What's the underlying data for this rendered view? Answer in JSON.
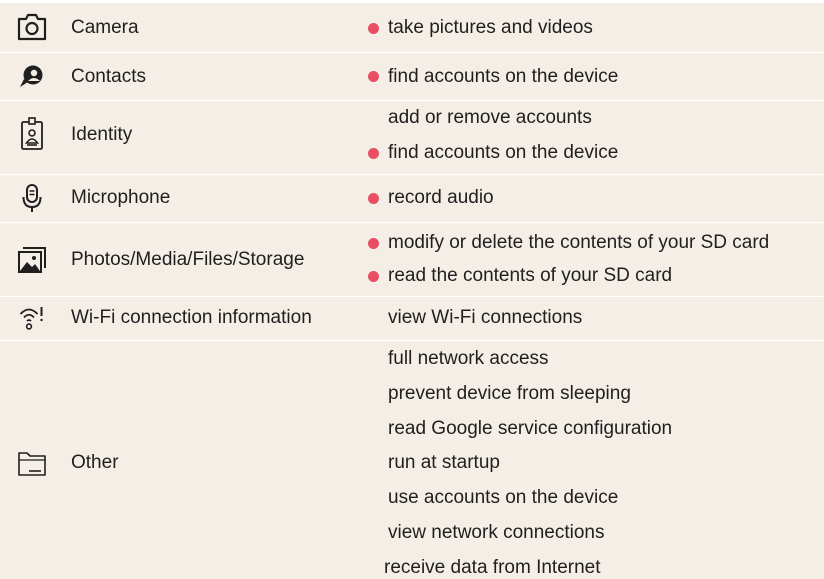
{
  "permissions": [
    {
      "name": "Camera",
      "icon": "camera-icon",
      "items": [
        {
          "text": "take pictures and videos",
          "flagged": true
        }
      ]
    },
    {
      "name": "Contacts",
      "icon": "contacts-icon",
      "items": [
        {
          "text": "find accounts on the device",
          "flagged": true
        }
      ]
    },
    {
      "name": "Identity",
      "icon": "identity-badge-icon",
      "items": [
        {
          "text": "add or remove accounts",
          "flagged": false
        },
        {
          "text": "find accounts on the device",
          "flagged": true
        }
      ]
    },
    {
      "name": "Microphone",
      "icon": "microphone-icon",
      "items": [
        {
          "text": "record audio",
          "flagged": true
        }
      ]
    },
    {
      "name": "Photos/Media/Files/Storage",
      "icon": "photos-icon",
      "items": [
        {
          "text": "modify or delete the contents of your SD card",
          "flagged": true
        },
        {
          "text": "read the contents of your SD card",
          "flagged": true
        }
      ]
    },
    {
      "name": "Wi-Fi connection information",
      "icon": "wifi-icon",
      "items": [
        {
          "text": "view Wi-Fi connections",
          "flagged": false
        }
      ]
    },
    {
      "name": "Other",
      "icon": "folder-icon",
      "items": [
        {
          "text": "full network access",
          "flagged": false
        },
        {
          "text": "prevent device from sleeping",
          "flagged": false
        },
        {
          "text": "read Google service configuration",
          "flagged": false
        },
        {
          "text": "run at startup",
          "flagged": false
        },
        {
          "text": "use accounts on the device",
          "flagged": false
        },
        {
          "text": "view network connections",
          "flagged": false
        },
        {
          "text": "receive data from Internet",
          "flagged": false
        }
      ]
    }
  ],
  "colors": {
    "flag_dot": "#ea4e62",
    "background": "#f4eee7",
    "divider": "#ffffff"
  }
}
